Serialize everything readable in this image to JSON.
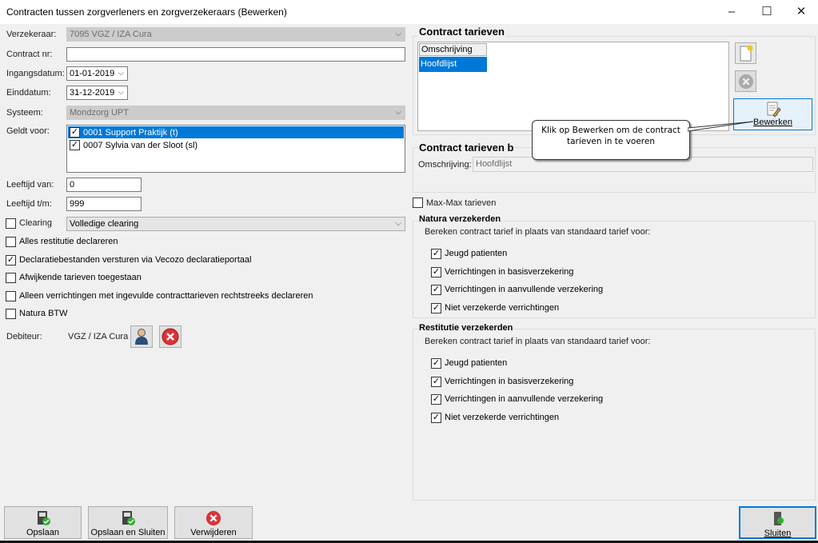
{
  "window": {
    "title": "Contracten tussen zorgverleners en zorgverzekeraars (Bewerken)",
    "minimize": "–",
    "maximize": "☐",
    "close": "✕"
  },
  "form": {
    "verzekeraar_label": "Verzekeraar:",
    "verzekeraar_value": "7095 VGZ / IZA Cura",
    "contractnr_label": "Contract nr:",
    "contractnr_value": "",
    "ingang_label": "Ingangsdatum:",
    "ingang_value": "01-01-2019",
    "eind_label": "Einddatum:",
    "eind_value": "31-12-2019",
    "systeem_label": "Systeem:",
    "systeem_value": "Mondzorg UPT",
    "geldt_label": "Geldt voor:",
    "geldt_items": [
      {
        "label": "0001 Support Praktijk (t)",
        "checked": true,
        "selected": true
      },
      {
        "label": "0007 Sylvia van der Sloot (sl)",
        "checked": true,
        "selected": false
      }
    ],
    "leeftijd_van_label": "Leeftijd van:",
    "leeftijd_van_value": "0",
    "leeftijd_tm_label": "Leeftijd t/m:",
    "leeftijd_tm_value": "999",
    "clearing_label": "Clearing",
    "clearing_checked": false,
    "clearing_value": "Volledige clearing",
    "checks": [
      {
        "label": "Alles restitutie declareren",
        "checked": false
      },
      {
        "label": "Declaratiebestanden versturen via Vecozo declaratieportaal",
        "checked": true
      },
      {
        "label": "Afwijkende tarieven toegestaan",
        "checked": false
      },
      {
        "label": "Alleen verrichtingen met ingevulde contracttarieven rechtstreeks declareren",
        "checked": false
      },
      {
        "label": "Natura BTW",
        "checked": false
      }
    ],
    "debiteur_label": "Debiteur:",
    "debiteur_value": "VGZ / IZA Cura"
  },
  "tarieven": {
    "title": "Contract tarieven",
    "column": "Omschrijving",
    "rows": [
      "Hoofdlijst"
    ],
    "edit_button": "Bewerken"
  },
  "tarieven_detail": {
    "title": "Contract tarieven b",
    "omschrijving_label": "Omschrijving:",
    "omschrijving_value": "Hoofdlijst"
  },
  "callout": "Klik op Bewerken om de contract tarieven in te voeren",
  "maxmax": {
    "label": "Max-Max tarieven",
    "checked": false
  },
  "natura": {
    "title": "Natura verzekerden",
    "text": "Bereken contract tarief in plaats van standaard tarief voor:",
    "items": [
      {
        "label": "Jeugd patienten",
        "checked": true
      },
      {
        "label": "Verrichtingen in basisverzekering",
        "checked": true
      },
      {
        "label": "Verrichtingen in aanvullende verzekering",
        "checked": true
      },
      {
        "label": "Niet verzekerde verrichtingen",
        "checked": true
      }
    ]
  },
  "restitutie": {
    "title": "Restitutie verzekerden",
    "text": "Bereken contract tarief in plaats van standaard tarief voor:",
    "items": [
      {
        "label": "Jeugd patienten",
        "checked": true
      },
      {
        "label": "Verrichtingen in basisverzekering",
        "checked": true
      },
      {
        "label": "Verrichtingen in aanvullende verzekering",
        "checked": true
      },
      {
        "label": "Niet verzekerde verrichtingen",
        "checked": true
      }
    ]
  },
  "footer": {
    "save": "Opslaan",
    "save_close": "Opslaan en Sluiten",
    "delete": "Verwijderen",
    "close": "Sluiten"
  },
  "colors": {
    "selection": "#0078d7",
    "accent_border": "#0078d7"
  }
}
